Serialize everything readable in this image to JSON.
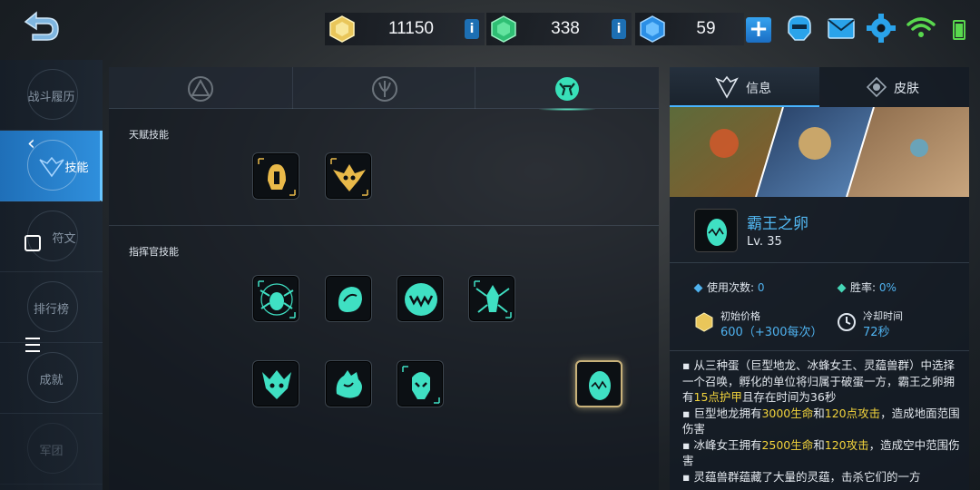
{
  "top_bar": {
    "gold": "11150",
    "crystal": "338",
    "diamond": "59",
    "plus": "+",
    "info": "i"
  },
  "sidebar": {
    "items": [
      {
        "label": "战斗履历"
      },
      {
        "label": "技能"
      },
      {
        "label": "符文"
      },
      {
        "label": "排行榜"
      },
      {
        "label": "成就"
      },
      {
        "label": "军团"
      }
    ]
  },
  "center": {
    "tabs": [
      "tab-1",
      "tab-2",
      "tab-3"
    ],
    "talent_title": "天赋技能",
    "commander_title": "指挥官技能"
  },
  "right": {
    "tab_info": "信息",
    "tab_skin": "皮肤",
    "unit_name": "霸王之卵",
    "unit_level": "Lv. 35",
    "uses_label": "使用次数:",
    "uses_value": "0",
    "winrate_label": "胜率:",
    "winrate_value": "0%",
    "price_label": "初始价格",
    "price_value": "600（+300每次）",
    "cooldown_label": "冷却时间",
    "cooldown_value": "72秒",
    "desc": {
      "p1_a": "▪ 从三种蛋（巨型地龙、冰蜂女王、灵蕴兽群）中选择一个召唤，孵化的单位将归属于破蛋一方，霸王之卵拥有",
      "p1_hl": "15点护甲",
      "p1_b": "且存在时间为36秒",
      "p2_a": "▪ 巨型地龙拥有",
      "p2_hl1": "3000生命",
      "p2_m": "和",
      "p2_hl2": "120点攻击",
      "p2_b": "，造成地面范围伤害",
      "p3_a": "▪ 冰峰女王拥有",
      "p3_hl1": "2500生命",
      "p3_m": "和",
      "p3_hl2": "120攻击",
      "p3_b": "，造成空中范围伤害",
      "p4": "▪ 灵蕴兽群蕴藏了大量的灵蕴，击杀它们的一方"
    }
  },
  "colors": {
    "accent_blue": "#52b8f3",
    "highlight_yellow": "#f3d43c",
    "skill_teal": "#3fe0c3",
    "skill_gold": "#e9b949"
  }
}
